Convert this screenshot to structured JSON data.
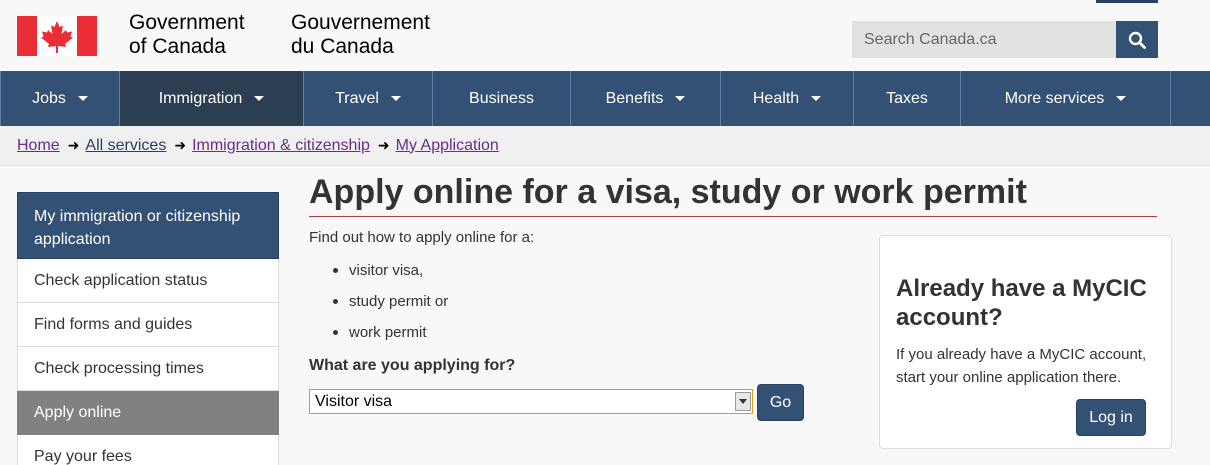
{
  "header": {
    "signature_en_line1": "Government",
    "signature_en_line2": "of Canada",
    "signature_fr_line1": "Gouvernement",
    "signature_fr_line2": "du Canada",
    "search_placeholder": "Search Canada.ca",
    "flag_color": "#eb2d37"
  },
  "nav": {
    "items": [
      {
        "label": "Jobs",
        "dropdown": true
      },
      {
        "label": "Immigration",
        "dropdown": true,
        "active": true
      },
      {
        "label": "Travel",
        "dropdown": true
      },
      {
        "label": "Business",
        "dropdown": false
      },
      {
        "label": "Benefits",
        "dropdown": true
      },
      {
        "label": "Health",
        "dropdown": true
      },
      {
        "label": "Taxes",
        "dropdown": false
      },
      {
        "label": "More services",
        "dropdown": true
      }
    ]
  },
  "breadcrumb": {
    "items": [
      "Home",
      "All services",
      "Immigration & citizenship",
      "My Application"
    ]
  },
  "sidebar": {
    "heading": "My immigration or citizenship application",
    "items": [
      {
        "label": "Check application status"
      },
      {
        "label": "Find forms and guides"
      },
      {
        "label": "Check processing times"
      },
      {
        "label": "Apply online",
        "active": true
      },
      {
        "label": "Pay your fees"
      }
    ]
  },
  "main": {
    "title": "Apply online for a visa, study or work permit",
    "intro": "Find out how to apply online for a:",
    "bullets": [
      "visitor visa,",
      "study permit or",
      "work permit"
    ],
    "question": "What are you applying for?",
    "select_value": "Visitor visa",
    "go_label": "Go"
  },
  "aside": {
    "title": "Already have a MyCIC account?",
    "text": "If you already have a MyCIC account, start your online application there.",
    "login_label": "Log in"
  },
  "colors": {
    "brand_blue": "#335075",
    "active_nav": "#2c3e51",
    "title_rule": "#af3c43",
    "link_visited": "#6a2a8f"
  }
}
